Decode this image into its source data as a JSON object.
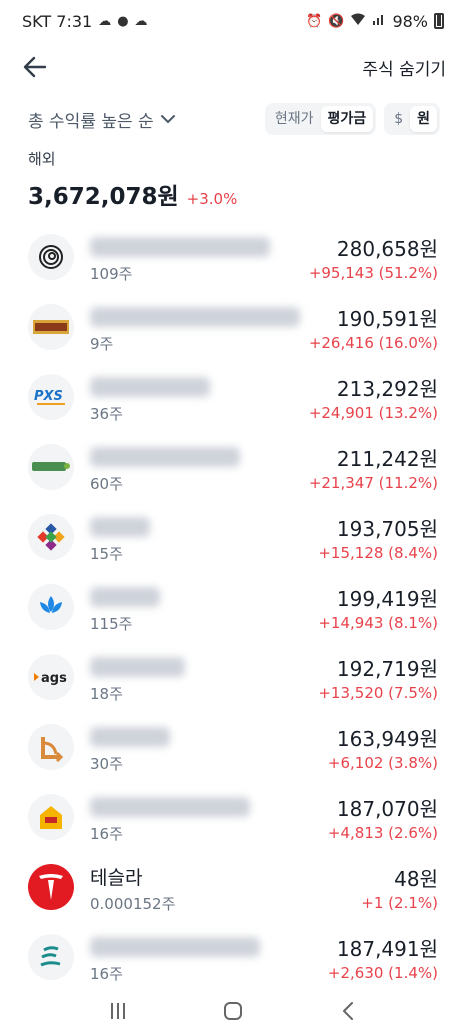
{
  "status_bar": {
    "carrier_time": "SKT 7:31",
    "battery": "98%"
  },
  "header": {
    "hide_label": "주식 숨기기"
  },
  "filters": {
    "sort_label": "총 수익률 높은 순",
    "price_options": [
      "현재가",
      "평가금"
    ],
    "price_selected": "평가금",
    "currency_options": [
      "$",
      "원"
    ],
    "currency_selected": "원"
  },
  "summary": {
    "region": "해외",
    "total": "3,672,078원",
    "change": "+3.0%"
  },
  "holdings": [
    {
      "logo": "circle-spiral-logo",
      "qty": "109주",
      "value": "280,658원",
      "gain": "+95,143 (51.2%)"
    },
    {
      "logo": "capital-logo",
      "qty": "9주",
      "value": "190,591원",
      "gain": "+26,416 (16.0%)"
    },
    {
      "logo": "pxs-logo",
      "qty": "36주",
      "value": "213,292원",
      "gain": "+24,901 (13.2%)"
    },
    {
      "logo": "sensus-logo",
      "qty": "60주",
      "value": "211,242원",
      "gain": "+21,347 (11.2%)"
    },
    {
      "logo": "knot-logo",
      "qty": "15주",
      "value": "193,705원",
      "gain": "+15,128 (8.4%)"
    },
    {
      "logo": "lotus-logo",
      "qty": "115주",
      "value": "199,419원",
      "gain": "+14,943 (8.1%)"
    },
    {
      "logo": "ags-logo",
      "qty": "18주",
      "value": "192,719원",
      "gain": "+13,520 (7.5%)"
    },
    {
      "logo": "curve-arrow-logo",
      "qty": "30주",
      "value": "163,949원",
      "gain": "+6,102 (3.8%)"
    },
    {
      "logo": "house-logo",
      "qty": "16주",
      "value": "187,070원",
      "gain": "+4,813 (2.6%)"
    },
    {
      "logo": "tesla-logo",
      "name": "테슬라",
      "qty": "0.000152주",
      "value": "48원",
      "gain": "+1 (2.1%)"
    },
    {
      "logo": "wave-e-logo",
      "qty": "16주",
      "value": "187,491원",
      "gain": "+2,630 (1.4%)"
    }
  ],
  "colors": {
    "gain_red": "#e8434b",
    "text_primary": "#191f28",
    "text_secondary": "#6b7684",
    "tesla_red": "#e21b22"
  }
}
